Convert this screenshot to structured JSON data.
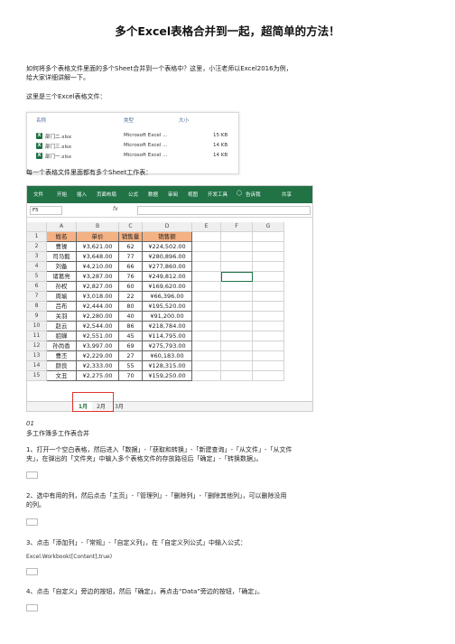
{
  "title": "多个Excel表格合并到一起，超简单的方法！",
  "intro_line1": "如何将多个表格文件里面的多个Sheet合并到一个表格中？这里，小汪老师以Excel2016为例，",
  "intro_line2": "给大家详细讲解一下。",
  "files_intro": "这里是三个Excel表格文件：",
  "explorer": {
    "headers": {
      "name": "名称",
      "type": "类型",
      "size": "大小"
    },
    "files": [
      {
        "name": "部门二.xlsx",
        "type": "Microsoft Excel ...",
        "size": "15 KB"
      },
      {
        "name": "部门三.xlsx",
        "type": "Microsoft Excel ...",
        "size": "14 KB"
      },
      {
        "name": "部门一.xlsx",
        "type": "Microsoft Excel ...",
        "size": "14 KB"
      }
    ]
  },
  "sheets_intro": "每一个表格文件里面都有多个Sheet工作表：",
  "excel": {
    "ribbon_tabs": [
      "文件",
      "开始",
      "插入",
      "页面布局",
      "公式",
      "数据",
      "审阅",
      "视图",
      "开发工具",
      "告诉我",
      "共享"
    ],
    "name_box": "F5",
    "fx": "fx",
    "col_headers": [
      "A",
      "B",
      "C",
      "D",
      "E",
      "F",
      "G"
    ],
    "table_header": [
      "姓名",
      "单价",
      "销售量",
      "销售额"
    ],
    "rows": [
      [
        "曹操",
        "¥3,621.00",
        "62",
        "¥224,502.00"
      ],
      [
        "司马懿",
        "¥3,648.00",
        "77",
        "¥280,896.00"
      ],
      [
        "刘备",
        "¥4,210.00",
        "66",
        "¥277,860.00"
      ],
      [
        "诸葛亮",
        "¥3,287.00",
        "76",
        "¥249,812.00"
      ],
      [
        "孙权",
        "¥2,827.00",
        "60",
        "¥169,620.00"
      ],
      [
        "周瑜",
        "¥3,018.00",
        "22",
        "¥66,396.00"
      ],
      [
        "吕布",
        "¥2,444.00",
        "80",
        "¥195,520.00"
      ],
      [
        "关羽",
        "¥2,280.00",
        "40",
        "¥91,200.00"
      ],
      [
        "赵云",
        "¥2,544.00",
        "86",
        "¥218,784.00"
      ],
      [
        "貂蝉",
        "¥2,551.00",
        "45",
        "¥114,795.00"
      ],
      [
        "孙尚香",
        "¥3,997.00",
        "69",
        "¥275,793.00"
      ],
      [
        "曹丕",
        "¥2,229.00",
        "27",
        "¥60,183.00"
      ],
      [
        "颜良",
        "¥2,333.00",
        "55",
        "¥128,315.00"
      ],
      [
        "文丑",
        "¥2,275.00",
        "70",
        "¥159,250.00"
      ]
    ],
    "sheet_tabs": [
      "1月",
      "2月",
      "3月"
    ]
  },
  "step_num": "01",
  "step_title": "多工作簿多工作表合并",
  "step1_line1": "1、打开一个空白表格，然后进入「数据」-「获取和转换」-「新建查询」-「从文件」-「从文件",
  "step1_line2": "夹」，在弹出的「文件夹」中输入多个表格文件的存放路径后「确定」-「转换数据」。",
  "step2_line1": "2、选中有用的列，然后点击「主页」-「管理列」-「删除列」-「删除其他列」，可以删除没用",
  "step2_line2": "的列。",
  "step3_line1": "3、点击「添加列」-「常规」-「自定义列」，在「自定义列公式」中输入公式：",
  "formula": "Excel.Workbook([Content],true)",
  "step4_line1": "4、点击「自定义」旁边的按钮，然后「确定」，再点击“Data”旁边的按钮，「确定」。"
}
